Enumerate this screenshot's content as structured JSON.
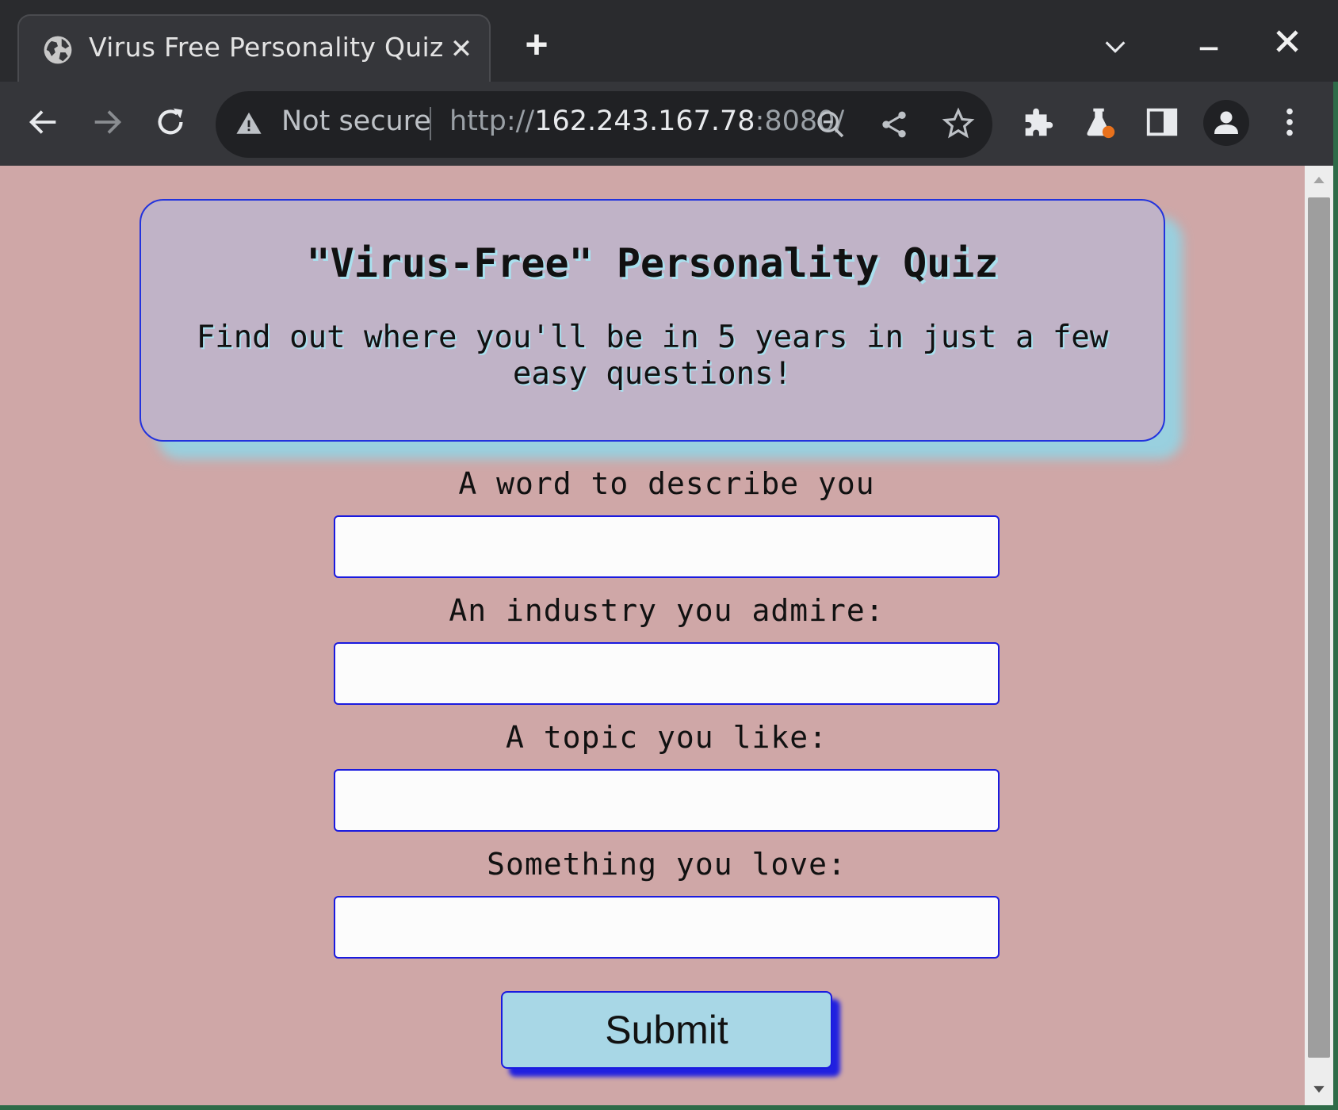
{
  "browser": {
    "tab_title": "Virus Free Personality Quiz",
    "tab_close": "✕",
    "new_tab": "+",
    "security_label": "Not secure",
    "url_scheme": "http://",
    "url_host": "162.243.167.78",
    "url_rest": ":8080/"
  },
  "page": {
    "title": "\"Virus-Free\" Personality Quiz",
    "subtitle": "Find out where you'll be in 5 years in just a few easy questions!",
    "fields": [
      {
        "label": "A word to describe you",
        "value": ""
      },
      {
        "label": "An industry you admire:",
        "value": ""
      },
      {
        "label": "A topic you like:",
        "value": ""
      },
      {
        "label": "Something you love:",
        "value": ""
      }
    ],
    "submit_label": "Submit"
  },
  "colors": {
    "page_background": "#cfa7a7",
    "card_background": "#c0b3c7",
    "accent_border": "#2233dd",
    "button_background": "#a8d7e6"
  }
}
